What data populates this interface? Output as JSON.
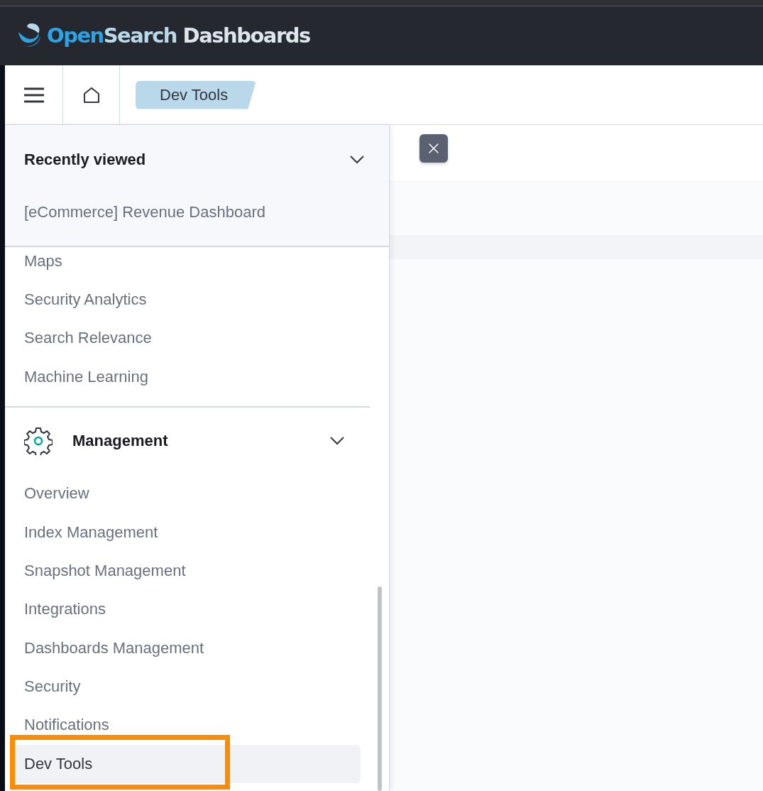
{
  "header": {
    "logo": [
      {
        "text": "Open",
        "color": "#2ea3e3"
      },
      {
        "text": "Search",
        "color": "#b9d9eb"
      },
      {
        "text": " Dashboards",
        "color": "#dfe5ef"
      }
    ]
  },
  "breadcrumbs": [
    {
      "label": "Dev Tools",
      "selected": true
    }
  ],
  "nav": {
    "recent": {
      "title": "Recently viewed",
      "expanded": true,
      "items": [
        {
          "label": "[eCommerce] Revenue Dashboard",
          "selected": false
        }
      ]
    },
    "items": [
      {
        "label": "Maps",
        "selected": false
      },
      {
        "label": "Security Analytics",
        "selected": false
      },
      {
        "label": "Search Relevance",
        "selected": false
      },
      {
        "label": "Machine Learning",
        "selected": false
      }
    ],
    "section": {
      "title": "Management",
      "expanded": true,
      "items": [
        {
          "label": "Overview",
          "selected": false,
          "highlighted": false
        },
        {
          "label": "Index Management",
          "selected": false,
          "highlighted": false
        },
        {
          "label": "Snapshot Management",
          "selected": false,
          "highlighted": false
        },
        {
          "label": "Integrations",
          "selected": false,
          "highlighted": false
        },
        {
          "label": "Dashboards Management",
          "selected": false,
          "highlighted": false
        },
        {
          "label": "Security",
          "selected": false,
          "highlighted": false
        },
        {
          "label": "Notifications",
          "selected": false,
          "highlighted": false
        },
        {
          "label": "Dev Tools",
          "selected": true,
          "highlighted": true
        }
      ]
    }
  }
}
